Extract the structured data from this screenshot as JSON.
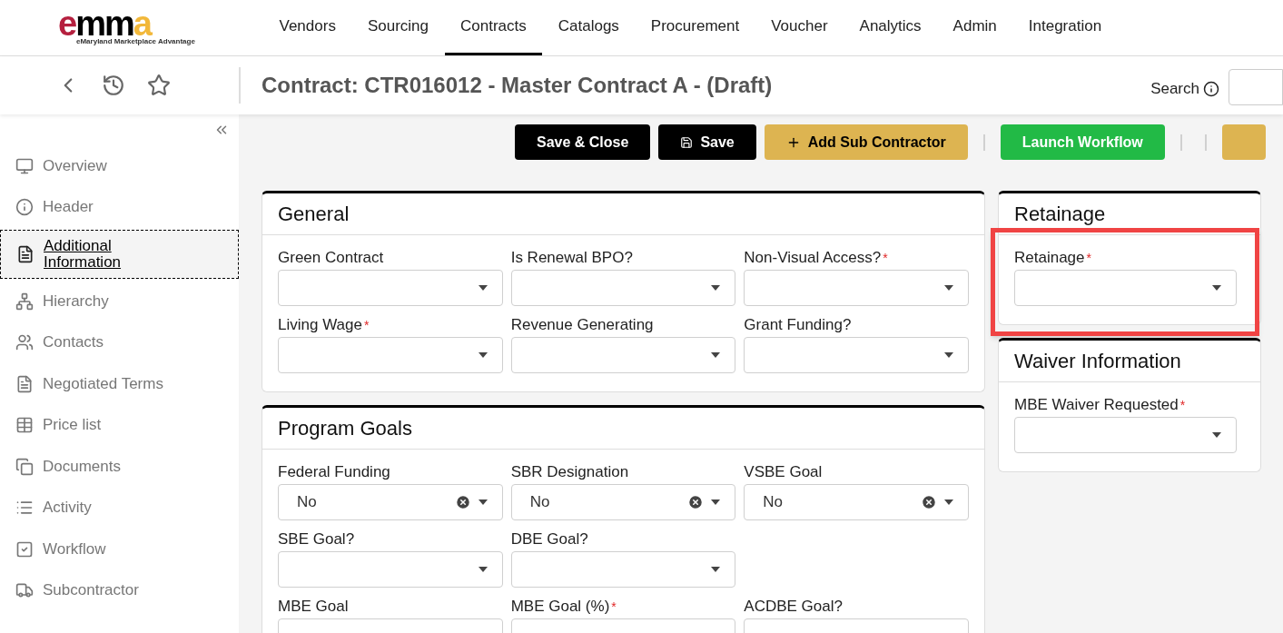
{
  "logo": {
    "letters": "emma",
    "tagline": "eMaryland Marketplace Advantage"
  },
  "nav": [
    {
      "label": "Vendors",
      "selected": false
    },
    {
      "label": "Sourcing",
      "selected": false
    },
    {
      "label": "Contracts",
      "selected": true
    },
    {
      "label": "Catalogs",
      "selected": false
    },
    {
      "label": "Procurement",
      "selected": false
    },
    {
      "label": "Voucher",
      "selected": false
    },
    {
      "label": "Analytics",
      "selected": false
    },
    {
      "label": "Admin",
      "selected": false
    },
    {
      "label": "Integration",
      "selected": false
    }
  ],
  "header": {
    "title": "Contract: CTR016012 - Master Contract A - (Draft)",
    "search_label": "Search"
  },
  "sidebar": {
    "items": [
      {
        "label": "Overview",
        "selected": false
      },
      {
        "label": "Header",
        "selected": false
      },
      {
        "label": "Additional Information",
        "selected": true
      },
      {
        "label": "Hierarchy",
        "selected": false
      },
      {
        "label": "Contacts",
        "selected": false
      },
      {
        "label": "Negotiated Terms",
        "selected": false
      },
      {
        "label": "Price list",
        "selected": false
      },
      {
        "label": "Documents",
        "selected": false
      },
      {
        "label": "Activity",
        "selected": false
      },
      {
        "label": "Workflow",
        "selected": false
      },
      {
        "label": "Subcontractor",
        "selected": false
      }
    ]
  },
  "toolbar": [
    {
      "kind": "dark",
      "label": "Save & Close"
    },
    {
      "kind": "dark",
      "label": "Save"
    },
    {
      "kind": "gold",
      "label": "Add Sub Contractor"
    },
    {
      "kind": "divider"
    },
    {
      "kind": "green",
      "label": "Launch Workflow"
    },
    {
      "kind": "divider"
    },
    {
      "kind": "divider"
    },
    {
      "kind": "gold"
    }
  ],
  "columns": [
    [
      {
        "title": "General",
        "rows": [
          [
            {
              "label": "Green Contract"
            },
            {
              "label": "Is Renewal BPO?"
            },
            {
              "label": "Non-Visual Access?",
              "required_mark": "*"
            }
          ],
          [
            {
              "label": "Living Wage",
              "required_mark": "*"
            },
            {
              "label": "Revenue Generating"
            },
            {
              "label": "Grant Funding?"
            }
          ]
        ]
      },
      {
        "title": "Program Goals",
        "rows": [
          [
            {
              "label": "Federal Funding",
              "value": "No"
            },
            {
              "label": "SBR Designation",
              "value": "No"
            },
            {
              "label": "VSBE Goal",
              "value": "No"
            }
          ],
          [
            {
              "label": "SBE Goal?"
            },
            {
              "label": "DBE Goal?"
            }
          ],
          [
            {
              "label": "MBE Goal"
            },
            {
              "label": "MBE Goal (%)",
              "required_mark": "*"
            },
            {
              "label": "ACDBE Goal?"
            }
          ]
        ]
      }
    ],
    [
      {
        "title": "Retainage",
        "rows": [
          [
            {
              "label": "Retainage",
              "required_mark": "*",
              "highlighted": true
            }
          ]
        ]
      },
      {
        "title": "Waiver Information",
        "rows": [
          [
            {
              "label": "MBE Waiver Requested",
              "required_mark": "*"
            }
          ]
        ]
      }
    ]
  ]
}
